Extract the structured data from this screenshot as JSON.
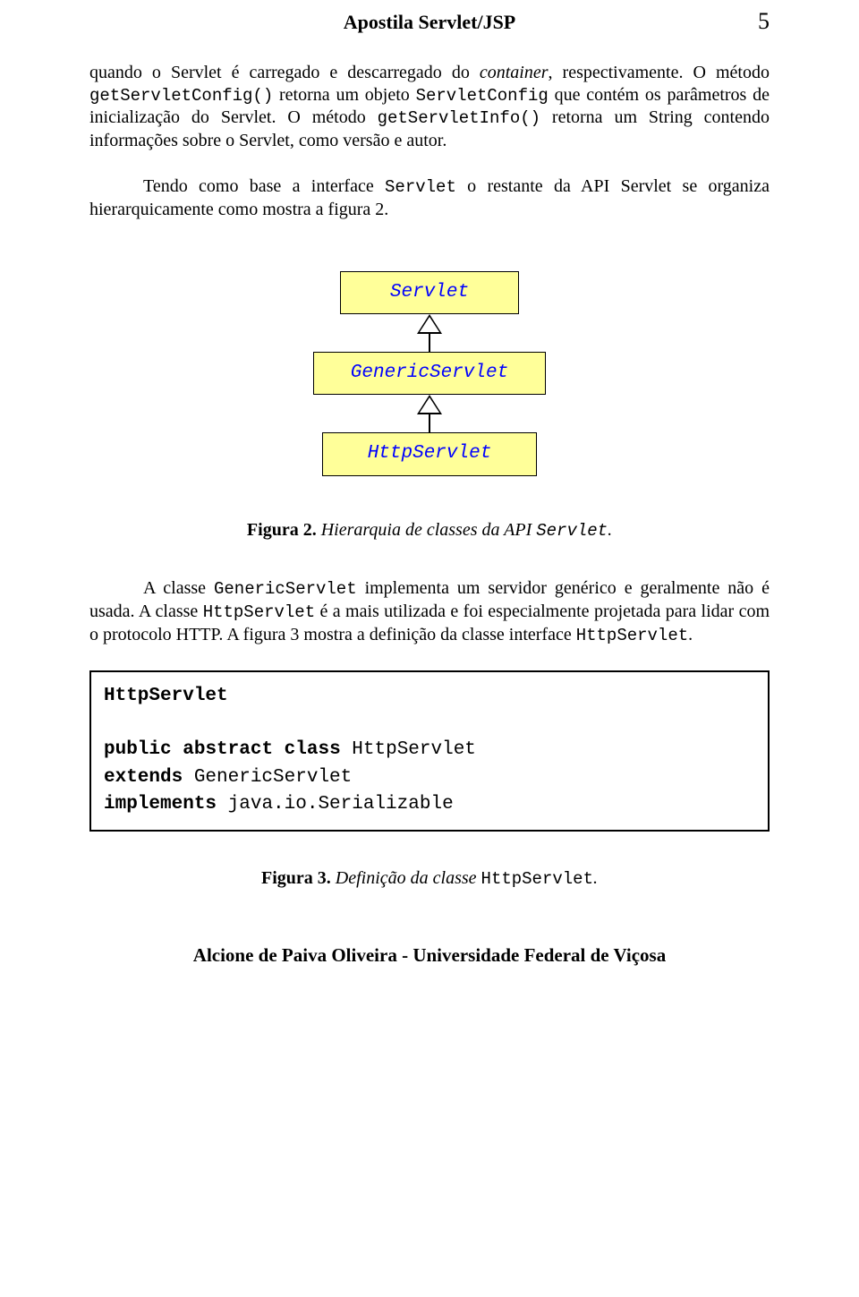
{
  "header": {
    "title": "Apostila Servlet/JSP",
    "page_number": "5"
  },
  "paragraphs": {
    "p1_pre": "quando o Servlet é carregado e descarregado do ",
    "p1_container": "container",
    "p1_after": ", respectivamente. O método ",
    "p1_code1": "getServletConfig()",
    "p1_mid1": " retorna um objeto ",
    "p1_code2": "ServletConfig",
    "p1_mid2": " que contém os parâmetros de inicialização do Servlet. O método ",
    "p1_code3": "getServletInfo()",
    "p1_end": " retorna um String contendo informações sobre o Servlet, como versão e autor.",
    "p2_pre": "Tendo como base a interface ",
    "p2_code": "Servlet",
    "p2_end": " o restante da API Servlet se organiza hierarquicamente como mostra a figura 2.",
    "p3_pre": "A classe ",
    "p3_code1": "GenericServlet",
    "p3_mid1": " implementa  um servidor genérico e geralmente não é usada. A classe ",
    "p3_code2": "HttpServlet",
    "p3_mid2": " é a mais utilizada e foi especialmente projetada para lidar com o protocolo HTTP. A figura 3 mostra a definição da classe interface ",
    "p3_code3": "HttpServlet",
    "p3_end": "."
  },
  "diagram": {
    "box1": "Servlet",
    "box2": "GenericServlet",
    "box3": "HttpServlet"
  },
  "fig2": {
    "label": "Figura 2.",
    "text_pre": " Hierarquia de classes da API  ",
    "code": "Servlet",
    "dot": "."
  },
  "codeblock": {
    "line1": "HttpServlet",
    "kw_public": "public",
    "kw_abstract": "abstract",
    "kw_class": "class",
    "cls": " HttpServlet",
    "kw_extends": "extends",
    "extends_cls": " GenericServlet",
    "kw_implements": "implements",
    "impl_cls": " java.io.Serializable"
  },
  "fig3": {
    "label": "Figura 3.",
    "text_pre": " Definição da classe ",
    "code": "HttpServlet",
    "dot": "."
  },
  "footer": "Alcione de Paiva Oliveira - Universidade Federal de Viçosa"
}
